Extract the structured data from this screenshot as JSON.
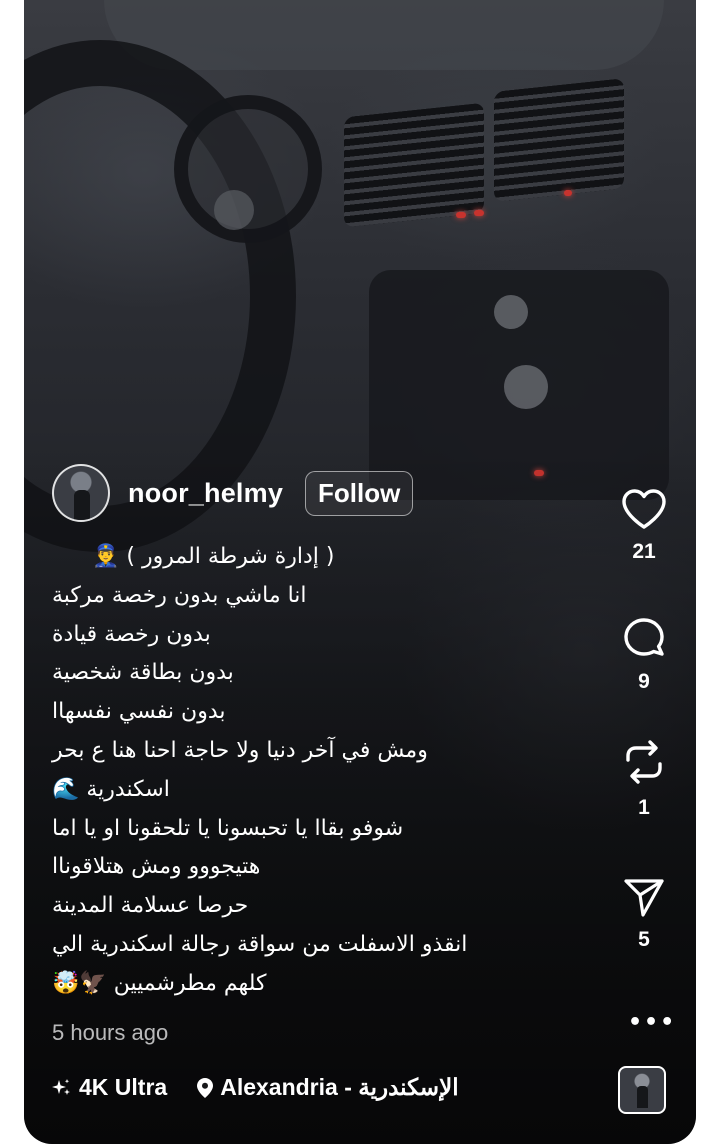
{
  "post": {
    "username": "noor_helmy",
    "follow_label": "Follow",
    "caption_lines": [
      "( إدارة شرطة المرور ) 👮‍♂️",
      "انا ماشي بدون رخصة مركبة",
      "بدون رخصة قيادة",
      "بدون بطاقة شخصية",
      "بدون نفسي نفسهاا",
      "ومش في آخر دنيا ولا حاجة احنا هنا ع بحر",
      "اسكندرية 🌊",
      "شوفو بقاا يا تحبسونا يا تلحقونا او يا اما",
      "هتيجووو ومش هتلاقوناا",
      "حرصا عسلامة المدينة",
      "انقذو الاسفلت من سواقة رجالة اسكندرية الي",
      "كلهم مطرشميين 🦅🤯"
    ],
    "timestamp": "5 hours ago",
    "quality_label": "4K Ultra",
    "location": "Alexandria - الإسكندرية"
  },
  "actions": {
    "likes": "21",
    "comments": "9",
    "reposts": "1",
    "shares": "5",
    "more_label": "•••"
  },
  "icons": {
    "like": "heart-icon",
    "comment": "comment-bubble-icon",
    "repost": "repost-icon",
    "share": "send-icon",
    "quality": "sparkle-icon",
    "location": "location-pin-icon"
  },
  "colors": {
    "text": "#ffffff",
    "background": "#1c1d21"
  }
}
